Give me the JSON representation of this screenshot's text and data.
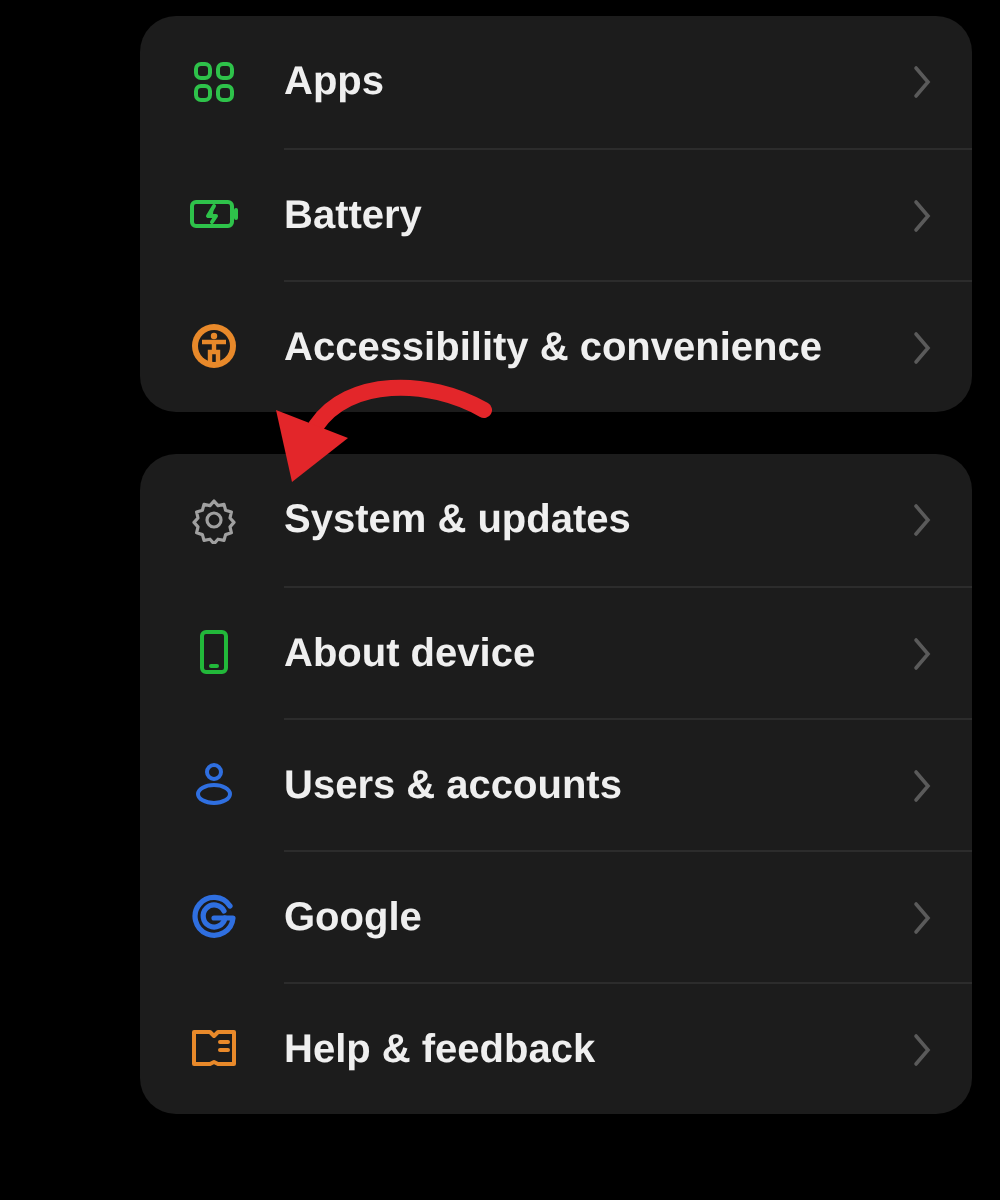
{
  "groups": [
    {
      "items": [
        {
          "label": "Apps",
          "color": "#2ec24a"
        },
        {
          "label": "Battery",
          "color": "#2ec24a"
        },
        {
          "label": "Accessibility & convenience",
          "color": "#e8892a"
        }
      ]
    },
    {
      "items": [
        {
          "label": "System & updates",
          "color": "#a0a0a0"
        },
        {
          "label": "About device",
          "color": "#22b83a"
        },
        {
          "label": "Users & accounts",
          "color": "#2f6fe0"
        },
        {
          "label": "Google",
          "color": "#2f6fe0"
        },
        {
          "label": "Help & feedback",
          "color": "#e8892a"
        }
      ]
    }
  ]
}
